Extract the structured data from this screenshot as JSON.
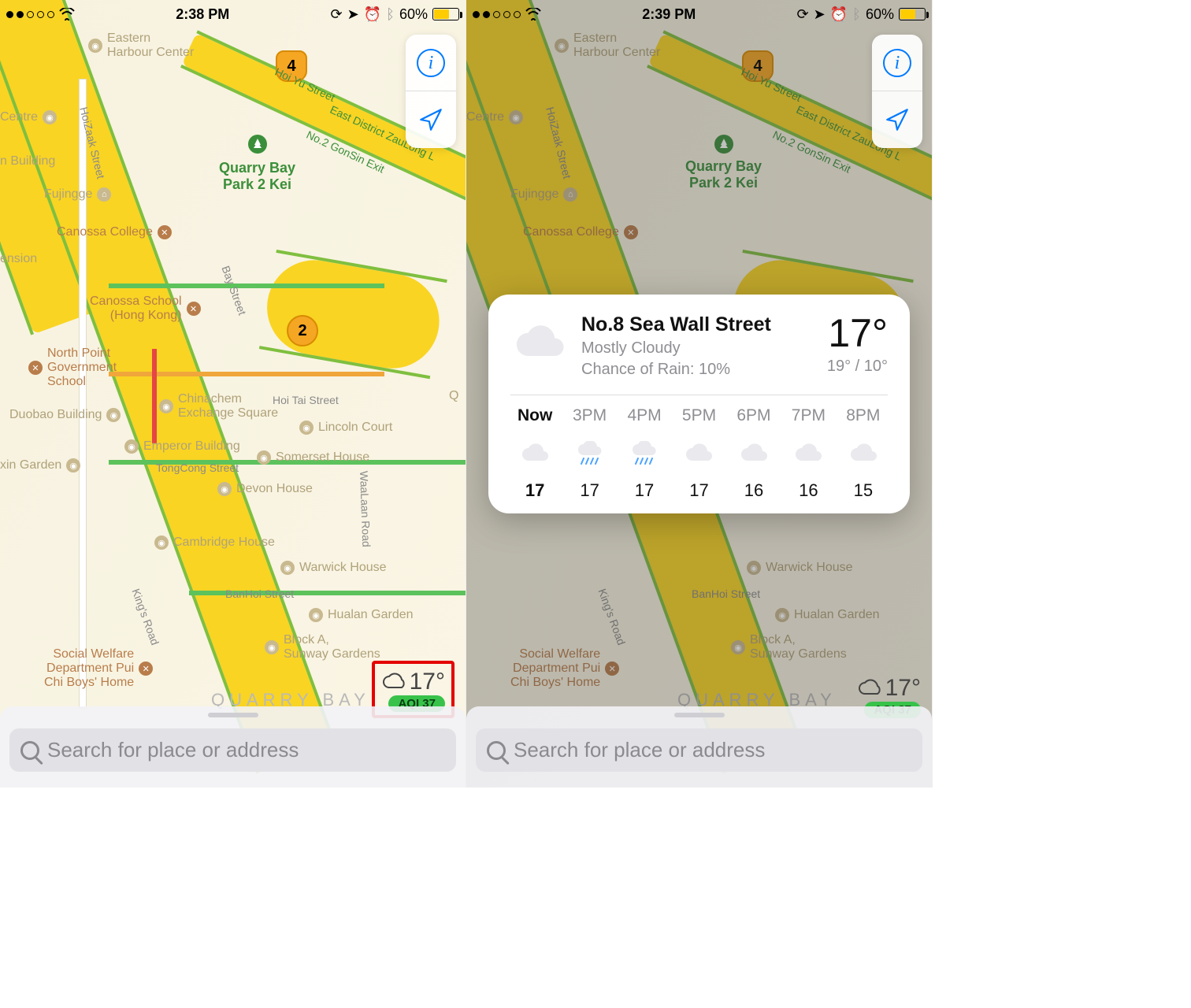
{
  "left": {
    "statusbar": {
      "time": "2:38 PM",
      "battery": "60%"
    },
    "map": {
      "shields": {
        "s4": "4",
        "s2": "2"
      },
      "streets": {
        "hoiyu": "Hoi Yu Street",
        "zaulong": "East District ZauLong L",
        "gonsin": "No.2 GonSin Exit",
        "hoizaak": "HoiZaak Street",
        "bay": "Bay Street",
        "hoitai": "Hoi Tai Street",
        "tongcong": "TongCong Street",
        "kings": "King's Road",
        "banhoi": "BanHoi Street",
        "waalaan": "WaaLaan Road"
      },
      "park": "Quarry Bay\nPark 2 Kei",
      "district": "QUARRY BAY",
      "poi": {
        "eastern": "Eastern\nHarbour Center",
        "centre": "Centre",
        "yin": "n Building",
        "fujingge": "Fujingge",
        "canossa_college": "Canossa College",
        "ension": "ension",
        "canossa_school": "Canossa School\n(Hong Kong)",
        "north_point": "North Point\nGovernment\nSchool",
        "duobao": "Duobao Building",
        "chinachem": "Chinachem\nExchange Square",
        "lincoln": "Lincoln Court",
        "emperor": "Emperor Building",
        "somerset": "Somerset House",
        "xin": "xin Garden",
        "devon": "Devon House",
        "cambridge": "Cambridge House",
        "warwick": "Warwick House",
        "hualan": "Hualan Garden",
        "blocka": "Block A,\nSunway Gardens",
        "welfare": "Social Welfare\nDepartment Pui\nChi Boys' Home",
        "q": "Q"
      }
    },
    "weather": {
      "temp": "17°",
      "aqi": "AQI 37"
    },
    "search": {
      "placeholder": "Search for place or address"
    }
  },
  "right": {
    "statusbar": {
      "time": "2:39 PM",
      "battery": "60%"
    },
    "weather_card": {
      "location": "No.8 Sea Wall Street",
      "condition": "Mostly Cloudy",
      "rain": "Chance of Rain: 10%",
      "temp": "17°",
      "range": "19° / 10°",
      "forecast": [
        {
          "time": "Now",
          "icon": "cloud",
          "temp": "17"
        },
        {
          "time": "3PM",
          "icon": "rain",
          "temp": "17"
        },
        {
          "time": "4PM",
          "icon": "rain",
          "temp": "17"
        },
        {
          "time": "5PM",
          "icon": "cloud",
          "temp": "17"
        },
        {
          "time": "6PM",
          "icon": "cloud",
          "temp": "16"
        },
        {
          "time": "7PM",
          "icon": "cloud",
          "temp": "16"
        },
        {
          "time": "8PM",
          "icon": "cloud",
          "temp": "15"
        }
      ]
    },
    "weather": {
      "temp": "17°",
      "aqi": "AQI 37"
    },
    "search": {
      "placeholder": "Search for place or address"
    }
  }
}
